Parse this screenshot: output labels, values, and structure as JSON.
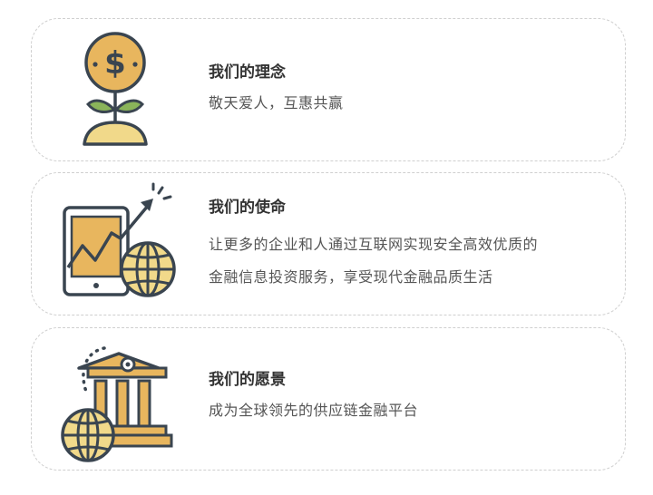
{
  "cards": [
    {
      "title": "我们的理念",
      "lines": [
        "敬天爱人，互惠共赢"
      ],
      "icon": "money-plant-icon"
    },
    {
      "title": "我们的使命",
      "lines": [
        "让更多的企业和人通过互联网实现安全高效优质的",
        "金融信息投资服务，享受现代金融品质生活"
      ],
      "icon": "tablet-growth-globe-icon"
    },
    {
      "title": "我们的愿景",
      "lines": [
        "成为全球领先的供应链金融平台"
      ],
      "icon": "bank-globe-icon"
    }
  ],
  "colors": {
    "outline": "#3a4550",
    "gold": "#e8b65e",
    "light_gold": "#f1d98a",
    "leaf": "#8ab45a",
    "title": "#333333",
    "text": "#555555",
    "border": "#cfcfcf"
  }
}
